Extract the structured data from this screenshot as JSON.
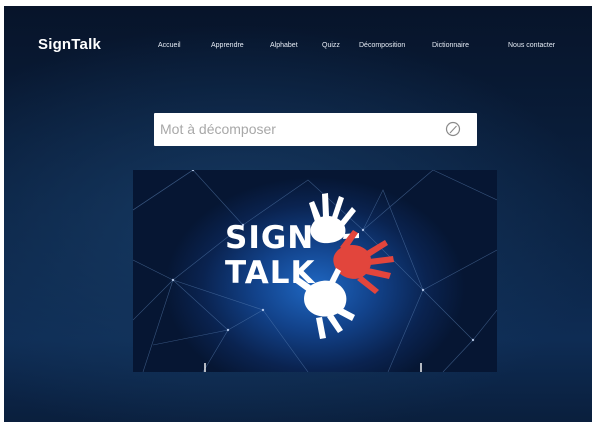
{
  "app": {
    "brand": "SignTalk"
  },
  "nav": {
    "items": [
      {
        "label": "Accueil"
      },
      {
        "label": "Apprendre"
      },
      {
        "label": "Alphabet"
      },
      {
        "label": "Quizz"
      },
      {
        "label": "Décomposition"
      },
      {
        "label": "Dictionnaire"
      },
      {
        "label": "Nous contacter"
      }
    ]
  },
  "search": {
    "placeholder": "Mot à décomposer",
    "value": "",
    "icon": "search-icon"
  },
  "hero": {
    "line1": "SIGN",
    "line2": "TALK",
    "icons": [
      "hand-white-top",
      "hand-red",
      "hand-white-bottom"
    ]
  },
  "colors": {
    "background": "#0b2344",
    "accent_red": "#e2453c",
    "text": "#ffffff"
  }
}
